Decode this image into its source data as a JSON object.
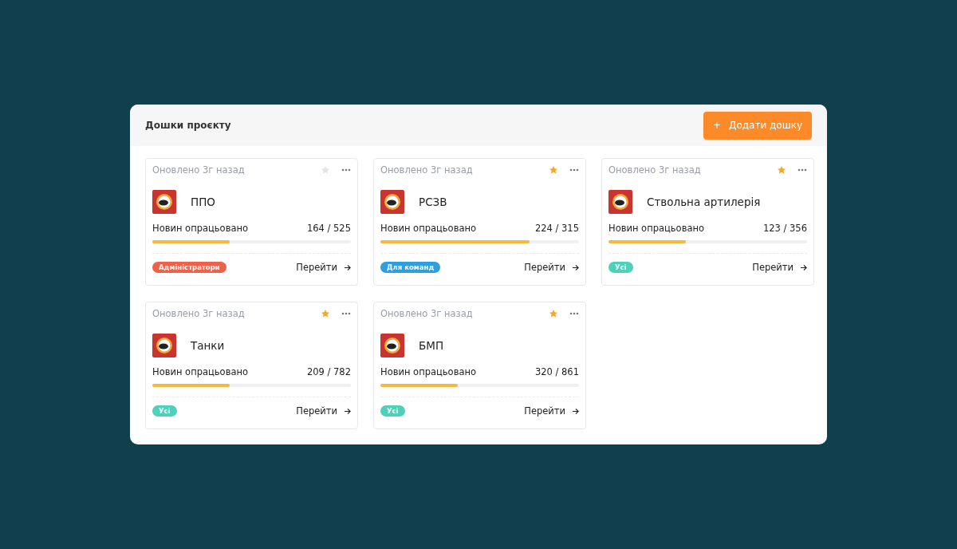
{
  "panel": {
    "title": "Дошки проєкту",
    "add_button": {
      "icon": "+",
      "label": "Додати дошку"
    }
  },
  "cards": [
    {
      "updated": "Оновлено 3г назад",
      "favorite": false,
      "name": "ППО",
      "progress_label": "Новин опрацьовано",
      "count": "164 / 525",
      "level": 0.39,
      "tag": {
        "label": "Адміністратори",
        "color": "#f0614a"
      },
      "link": "Перейти"
    },
    {
      "updated": "Оновлено 3г назад",
      "favorite": true,
      "name": "РСЗВ",
      "progress_label": "Новин опрацьовано",
      "count": "224 / 315",
      "level": 0.75,
      "tag": {
        "label": "Для команд",
        "color": "#2d9fe0"
      },
      "link": "Перейти"
    },
    {
      "updated": "Оновлено 3г назад",
      "favorite": true,
      "name": "Ствольна артилерія",
      "progress_label": "Новин опрацьовано",
      "count": "123 / 356",
      "level": 0.39,
      "tag": {
        "label": "Усі",
        "color": "#4dd1b8"
      },
      "link": "Перейти"
    },
    {
      "updated": "Оновлено 3г назад",
      "favorite": true,
      "name": "Танки",
      "progress_label": "Новин опрацьовано",
      "count": "209 / 782",
      "level": 0.39,
      "tag": {
        "label": "Усі",
        "color": "#4dd1b8"
      },
      "link": "Перейти"
    },
    {
      "updated": "Оновлено 3г назад",
      "favorite": true,
      "name": "БМП",
      "progress_label": "Новин опрацьовано",
      "count": "320 / 861",
      "level": 0.39,
      "tag": {
        "label": "Усі",
        "color": "#4dd1b8"
      },
      "link": "Перейти"
    }
  ]
}
